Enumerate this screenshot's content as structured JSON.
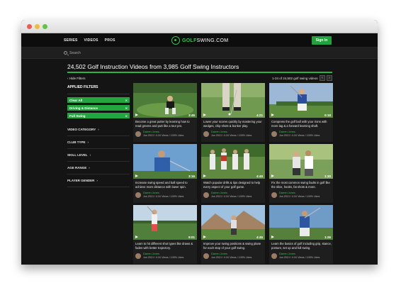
{
  "nav": {
    "links": [
      "SERIES",
      "VIDEOS",
      "PROS"
    ],
    "logo_prefix": "GOLF",
    "logo_suffix": "SWING.COM",
    "signin_label": "Sign In"
  },
  "search": {
    "placeholder": "Search"
  },
  "page": {
    "title": "24,502 Golf Instruction Videos from 3,985 Golf Swing Instructors",
    "hide_filters": "‹ Hide Filters",
    "results_count": "1-24 of 24,502 golf swing videos",
    "prev": "‹",
    "next": "›"
  },
  "filters": {
    "applied_label": "APPLIED FILTERS",
    "chips": [
      "Clear All",
      "Driving & Distance",
      "Full Swing"
    ],
    "chip_close": "✕",
    "facets": [
      "VIDEO CATEGORY",
      "CLUB TYPE",
      "SKILL LEVEL",
      "AGE RANGE",
      "PLAYER GENDER"
    ],
    "facet_chevron": "›"
  },
  "videos": [
    {
      "duration": "3:45",
      "desc": "Become a great putter by learning how to read greens and putt like a tour pro.",
      "author": "Darren Jones",
      "stats": "Jun 2013 / 4.1K Views / 100% Likes",
      "scene": "putting"
    },
    {
      "duration": "4:21",
      "desc": "Lower your scores quickly by mastering your wedges, chip shots & bunker play.",
      "author": "Darren Jones",
      "stats": "Jun 2013 / 4.1K Views / 100% Likes",
      "scene": "chip"
    },
    {
      "duration": "0:18",
      "desc": "Compress the golf ball with your irons with more lag & a forward learning shaft.",
      "author": "Darren Jones",
      "stats": "Jun 2013 / 4.1K Views / 100% Likes",
      "scene": "iron"
    },
    {
      "duration": "3:16",
      "desc": "Increase swing speed and ball speed to achieve more distance with lower spin.",
      "author": "Darren Jones",
      "stats": "Jun 2013 / 4.1K Views / 100% Likes",
      "scene": "driver"
    },
    {
      "duration": "4:40",
      "desc": "Watch popular drills & tips designed to help every aspect of your golf game.",
      "author": "Darren Jones",
      "stats": "Jun 2013 / 4.1K Views / 100% Likes",
      "scene": "group"
    },
    {
      "duration": "1:30",
      "desc": "Fix the most common swing faults in golf like the slice, hooks, fat shots & more.",
      "author": "Darren Jones",
      "stats": "Jun 2013 / 4.1K Views / 100% Likes",
      "scene": "lesson"
    },
    {
      "duration": "9:01",
      "desc": "Learn to hit different shot types like draws & fades with better trajectory.",
      "author": "Darren Jones",
      "stats": "Jun 2013 / 4.1K Views / 100% Likes",
      "scene": "finish"
    },
    {
      "duration": "4:45",
      "desc": "Improve your swing positions & swing plane for each stop of your golf swing.",
      "author": "Darren Jones",
      "stats": "Jun 2013 / 4.1K Views / 100% Likes",
      "scene": "mountain"
    },
    {
      "duration": "1:26",
      "desc": "Learn the basics of golf including grip, stance, posture, set up and full swing.",
      "author": "Darren Jones",
      "stats": "Jun 2013 / 4.1K Views / 100% Likes",
      "scene": "backswing"
    }
  ],
  "colors": {
    "accent": "#22a63d",
    "background": "#141414",
    "card": "#1e1e1e",
    "author": "#33c24f"
  }
}
